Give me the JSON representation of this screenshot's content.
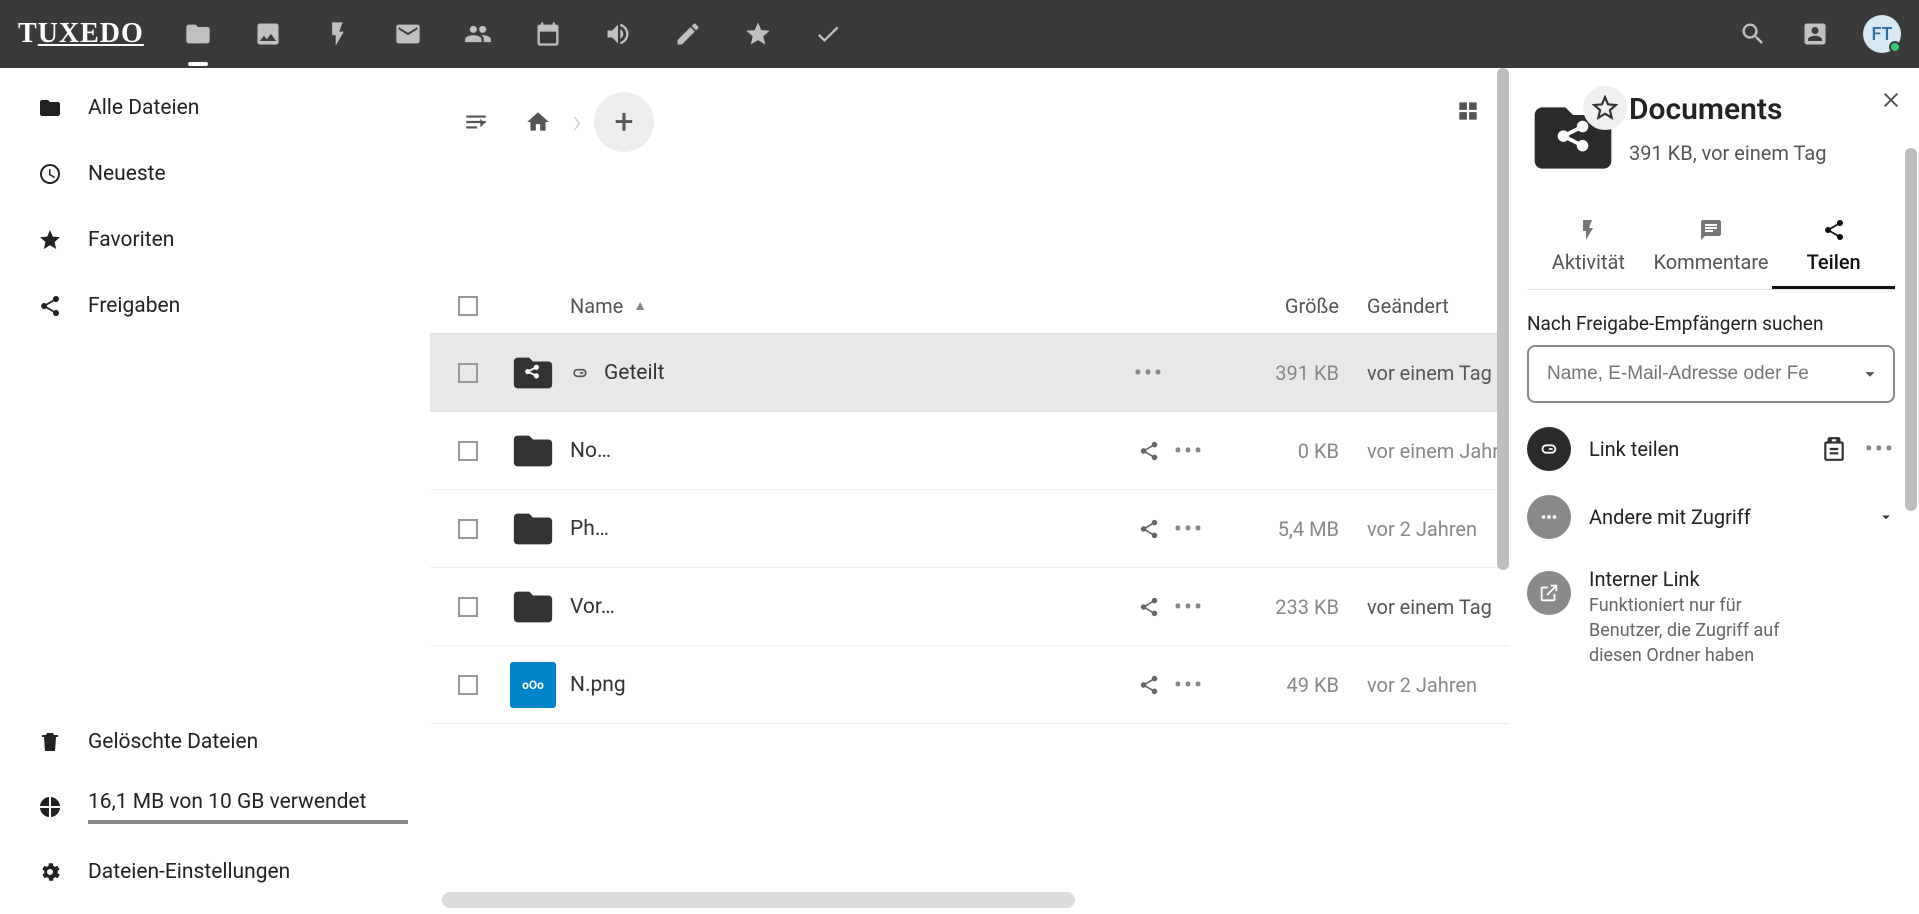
{
  "brand": {
    "text": "TUXEDO"
  },
  "avatar": {
    "initials": "FT"
  },
  "sidebar": {
    "items": [
      {
        "label": "Alle Dateien"
      },
      {
        "label": "Neueste"
      },
      {
        "label": "Favoriten"
      },
      {
        "label": "Freigaben"
      }
    ],
    "footer": {
      "trash": "Gelöschte Dateien",
      "quota": "16,1 MB von 10 GB verwendet",
      "settings": "Dateien-Einstellungen"
    }
  },
  "table": {
    "headers": {
      "name": "Name",
      "size": "Größe",
      "modified": "Geändert"
    },
    "rows": [
      {
        "name": "Geteilt",
        "shared": true,
        "thumb": "folder-link",
        "size": "391 KB",
        "modified": "vor einem Tag",
        "mod_muted": false,
        "selected": true
      },
      {
        "name": "No…",
        "shared": false,
        "thumb": "folder",
        "size": "0 KB",
        "modified": "vor einem Jahr",
        "mod_muted": true,
        "selected": false
      },
      {
        "name": "Ph…",
        "shared": false,
        "thumb": "folder",
        "size": "5,4 MB",
        "modified": "vor 2 Jahren",
        "mod_muted": true,
        "selected": false
      },
      {
        "name": "Vor…",
        "shared": false,
        "thumb": "folder",
        "size": "233 KB",
        "modified": "vor einem Tag",
        "mod_muted": false,
        "selected": false
      },
      {
        "name": "N.png",
        "shared": false,
        "thumb": "nextcloud",
        "size": "49 KB",
        "modified": "vor 2 Jahren",
        "mod_muted": true,
        "selected": false
      }
    ]
  },
  "details": {
    "title": "Documents",
    "meta": "391 KB, vor einem Tag",
    "tabs": {
      "activity": "Aktivität",
      "comments": "Kommentare",
      "share": "Teilen"
    },
    "share": {
      "search_label": "Nach Freigabe-Empfängern suchen",
      "search_placeholder": "Name, E-Mail-Adresse oder Fe",
      "link_share": "Link teilen",
      "others": "Andere mit Zugriff",
      "internal_title": "Interner Link",
      "internal_sub": "Funktioniert nur für Benutzer, die Zugriff auf diesen Ordner haben"
    }
  }
}
